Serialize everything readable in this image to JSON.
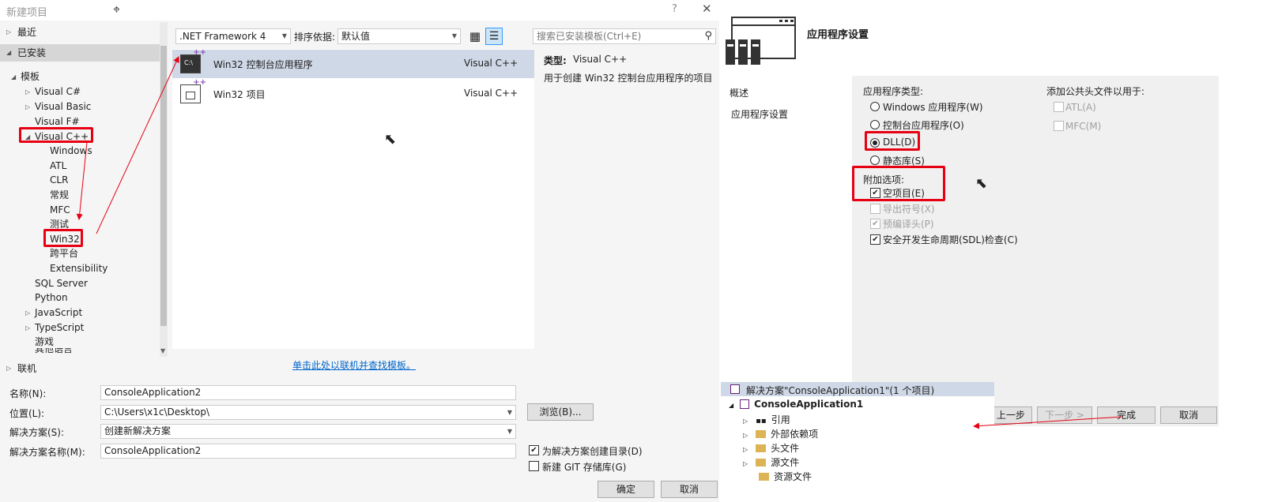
{
  "left_dialog": {
    "title": "新建项目",
    "help": "?",
    "close": "✕",
    "sections": {
      "recent": "最近",
      "installed": "已安装",
      "online": "联机"
    },
    "tree": {
      "templates": "模板",
      "items": [
        "Visual C#",
        "Visual Basic",
        "Visual F#",
        "Visual C++",
        "Windows",
        "ATL",
        "CLR",
        "常规",
        "MFC",
        "测试",
        "Win32",
        "跨平台",
        "Extensibility",
        "SQL Server",
        "Python",
        "JavaScript",
        "TypeScript",
        "游戏"
      ],
      "partial": "其他语言"
    },
    "toolbar": {
      "framework": ".NET Framework 4",
      "sort_label": "排序依据:",
      "sort_value": "默认值",
      "search_placeholder": "搜索已安装模板(Ctrl+E)"
    },
    "templates": [
      {
        "name": "Win32 控制台应用程序",
        "lang": "Visual C++",
        "icon_text": "C:\\"
      },
      {
        "name": "Win32 项目",
        "lang": "Visual C++",
        "icon_text": ""
      }
    ],
    "description": {
      "type_label": "类型:",
      "type_value": "Visual C++",
      "text": "用于创建 Win32 控制台应用程序的项目"
    },
    "online_link": "单击此处以联机并查找模板。",
    "form": {
      "name_label": "名称(N):",
      "name_value": "ConsoleApplication2",
      "location_label": "位置(L):",
      "location_value": "C:\\Users\\x1c\\Desktop\\",
      "solution_label": "解决方案(S):",
      "solution_value": "创建新解决方案",
      "solution_name_label": "解决方案名称(M):",
      "solution_name_value": "ConsoleApplication2",
      "browse": "浏览(B)...",
      "create_dir": "为解决方案创建目录(D)",
      "create_dir_checked": true,
      "git": "新建 GIT 存储库(G)",
      "git_checked": false,
      "ok": "确定",
      "cancel": "取消"
    }
  },
  "wizard": {
    "title": "应用程序设置",
    "nav": [
      "概述",
      "应用程序设置"
    ],
    "app_type_label": "应用程序类型:",
    "app_types": [
      {
        "label": "Windows 应用程序(W)",
        "selected": false
      },
      {
        "label": "控制台应用程序(O)",
        "selected": false
      },
      {
        "label": "DLL(D)",
        "selected": true
      },
      {
        "label": "静态库(S)",
        "selected": false
      }
    ],
    "extra_label": "附加选项:",
    "extras": [
      {
        "label": "空项目(E)",
        "checked": true,
        "disabled": false
      },
      {
        "label": "导出符号(X)",
        "checked": false,
        "disabled": true
      },
      {
        "label": "预编译头(P)",
        "checked": true,
        "disabled": true
      },
      {
        "label": "安全开发生命周期(SDL)检查(C)",
        "checked": true,
        "disabled": false
      }
    ],
    "header_label": "添加公共头文件以用于:",
    "headers": [
      {
        "label": "ATL(A)",
        "checked": false
      },
      {
        "label": "MFC(M)",
        "checked": false
      }
    ],
    "buttons": {
      "prev": "< 上一步",
      "next": "下一步 >",
      "finish": "完成",
      "cancel": "取消"
    }
  },
  "solution_explorer": {
    "solution": "解决方案\"ConsoleApplication1\"(1 个项目)",
    "project": "ConsoleApplication1",
    "nodes": [
      "引用",
      "外部依赖项",
      "头文件",
      "源文件",
      "资源文件"
    ]
  },
  "colors": {
    "annotation_red": "#e60012",
    "selection": "#cfd8e6"
  }
}
